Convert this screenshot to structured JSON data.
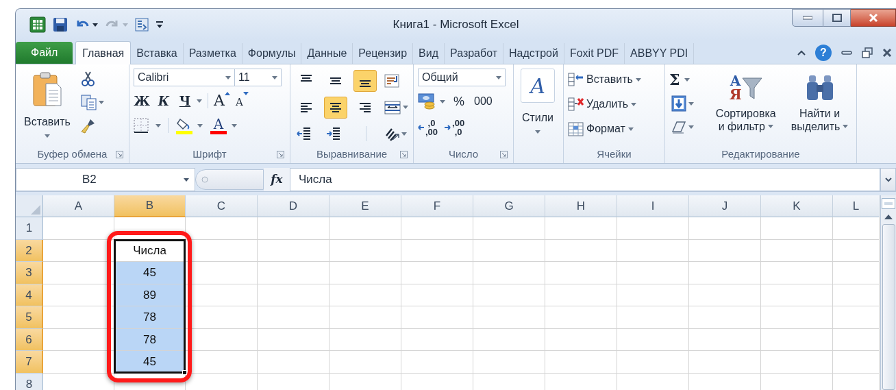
{
  "window": {
    "title": "Книга1 - Microsoft Excel"
  },
  "tabs": [
    {
      "label": "Файл",
      "kind": "file",
      "selected": false
    },
    {
      "label": "Главная",
      "kind": "tab",
      "selected": true
    },
    {
      "label": "Вставка",
      "kind": "tab",
      "selected": false
    },
    {
      "label": "Разметка",
      "kind": "tab",
      "selected": false
    },
    {
      "label": "Формулы",
      "kind": "tab",
      "selected": false
    },
    {
      "label": "Данные",
      "kind": "tab",
      "selected": false
    },
    {
      "label": "Рецензир",
      "kind": "tab",
      "selected": false
    },
    {
      "label": "Вид",
      "kind": "tab",
      "selected": false
    },
    {
      "label": "Разработ",
      "kind": "tab",
      "selected": false
    },
    {
      "label": "Надстрой",
      "kind": "tab",
      "selected": false
    },
    {
      "label": "Foxit PDF",
      "kind": "tab",
      "selected": false
    },
    {
      "label": "ABBYY PDI",
      "kind": "tab",
      "selected": false
    }
  ],
  "ribbon_controls": {
    "help": "?"
  },
  "ribbon": {
    "clipboard": {
      "label": "Буфер обмена",
      "paste": "Вставить"
    },
    "font": {
      "label": "Шрифт",
      "font_name": "Calibri",
      "font_size": "11",
      "bold": "Ж",
      "italic": "К",
      "underline": "Ч",
      "grow": "A",
      "shrink": "A",
      "font_color": "A"
    },
    "alignment": {
      "label": "Выравнивание",
      "vertical": [
        {
          "selected": false
        },
        {
          "selected": false
        },
        {
          "selected": true
        }
      ],
      "horizontal": [
        {
          "selected": false
        },
        {
          "selected": true
        },
        {
          "selected": false
        }
      ]
    },
    "number": {
      "label": "Число",
      "format": "Общий",
      "percent": "%",
      "thousands": "000",
      "decimals": [
        [
          ",0",
          ",00"
        ],
        [
          ",00",
          ",0"
        ]
      ]
    },
    "styles": {
      "label": "Стили",
      "icon_letter": "A"
    },
    "cells": {
      "label": "Ячейки",
      "buttons": [
        {
          "kind": "insert",
          "label": "Вставить"
        },
        {
          "kind": "delete",
          "label": "Удалить"
        },
        {
          "kind": "format",
          "label": "Формат"
        }
      ]
    },
    "editing": {
      "label": "Редактирование",
      "sum": "Σ",
      "sort": {
        "lines": [
          "Сортировка",
          "и фильтр"
        ],
        "letters": [
          "А",
          "Я"
        ]
      },
      "find": {
        "lines": [
          "Найти и",
          "выделить"
        ]
      }
    }
  },
  "formula_bar": {
    "name_box": "B2",
    "fx": "fx",
    "value": "Числа"
  },
  "sheet": {
    "columns": [
      {
        "label": "A",
        "selected": false
      },
      {
        "label": "B",
        "selected": true
      },
      {
        "label": "C",
        "selected": false
      },
      {
        "label": "D",
        "selected": false
      },
      {
        "label": "E",
        "selected": false
      },
      {
        "label": "F",
        "selected": false
      },
      {
        "label": "G",
        "selected": false
      },
      {
        "label": "H",
        "selected": false
      },
      {
        "label": "I",
        "selected": false
      },
      {
        "label": "J",
        "selected": false
      },
      {
        "label": "K",
        "selected": false
      },
      {
        "label": "L",
        "selected": false
      }
    ],
    "rows": [
      {
        "header": "1",
        "selected": false
      },
      {
        "header": "2",
        "selected": true,
        "cell_b": {
          "text": "Числа",
          "active": true
        }
      },
      {
        "header": "3",
        "selected": true,
        "cell_b": {
          "text": "45",
          "active": false
        }
      },
      {
        "header": "4",
        "selected": true,
        "cell_b": {
          "text": "89",
          "active": false
        }
      },
      {
        "header": "5",
        "selected": true,
        "cell_b": {
          "text": "78",
          "active": false
        }
      },
      {
        "header": "6",
        "selected": true,
        "cell_b": {
          "text": "78",
          "active": false
        }
      },
      {
        "header": "7",
        "selected": true,
        "cell_b": {
          "text": "45",
          "active": false
        }
      },
      {
        "header": "8",
        "selected": false
      }
    ]
  }
}
